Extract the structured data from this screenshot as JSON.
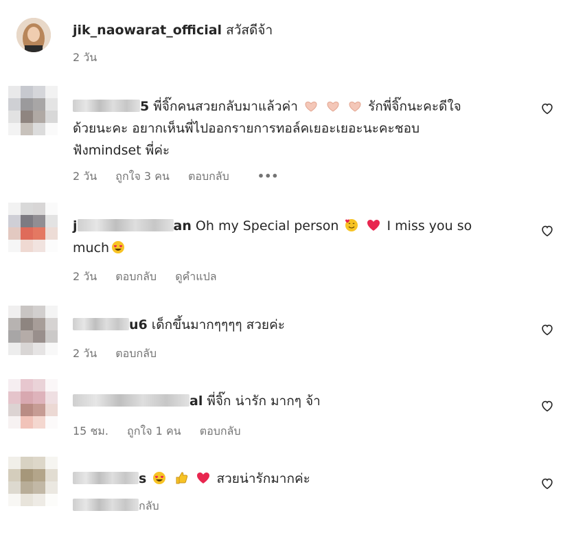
{
  "post": {
    "username": "jik_naowarat_official",
    "caption": "สวัสดีจ้า",
    "time": "2 วัน"
  },
  "comments": [
    {
      "username_visible": "5",
      "text_lines": [
        "พี่จิ๊กคนสวยกลับมาแล้วค่า",
        "รักพี่จิ๊กนะคะดีใจ",
        "ด้วยนะคะ อยากเห็นพี่ไปออกรายการทอล์คเยอะเยอะนะคะชอบ",
        "ฟังmindset พี่ค่ะ"
      ],
      "time": "2 วัน",
      "likes": "ถูกใจ 3 คน",
      "reply": "ตอบกลับ",
      "more": "•••"
    },
    {
      "username_prefix": "j",
      "username_visible": "an",
      "text_a": "Oh my Special person",
      "text_b": "I miss you so",
      "text_c": "much",
      "time": "2 วัน",
      "reply": "ตอบกลับ",
      "translate": "ดูคำแปล"
    },
    {
      "username_visible": "u6",
      "text": "เด็กขึ้นมากๆๆๆๆ สวยค่ะ",
      "time": "2 วัน",
      "reply": "ตอบกลับ"
    },
    {
      "username_visible": "al",
      "text": "พี่จิ๊ก น่ารัก มากๆ จ้า",
      "time": "15 ชม.",
      "likes": "ถูกใจ 1 คน",
      "reply": "ตอบกลับ"
    },
    {
      "username_visible": "s",
      "text": "สวยน่ารักมากค่ะ",
      "reply_partial": "กลับ"
    }
  ],
  "icons": {
    "like": "heart-outline-icon"
  },
  "colors": {
    "text": "#262626",
    "meta": "#737373"
  }
}
